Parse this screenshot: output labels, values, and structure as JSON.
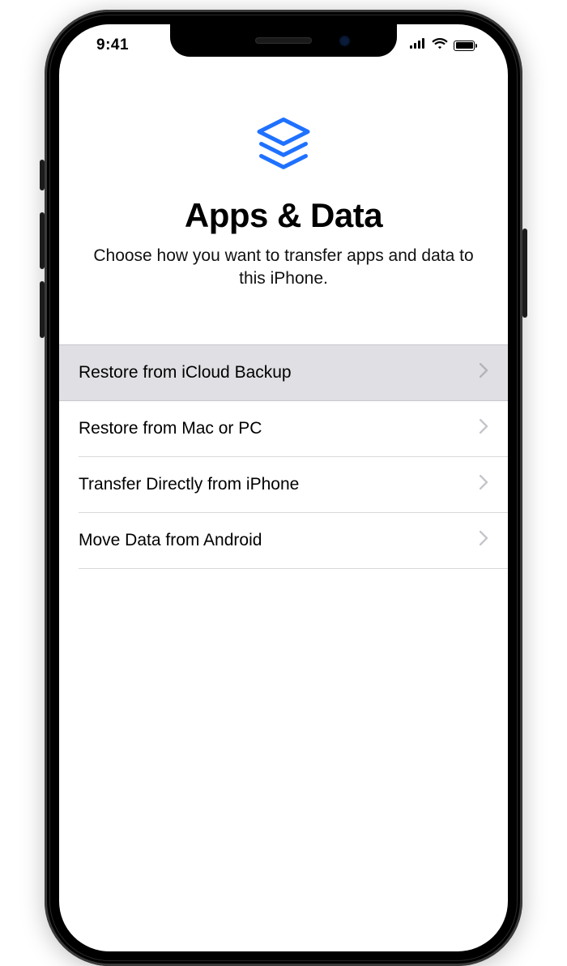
{
  "status": {
    "time": "9:41"
  },
  "colors": {
    "accent": "#1f71ff",
    "selected_bg": "#e0dfe3"
  },
  "hero": {
    "icon_name": "layers-icon",
    "title": "Apps & Data",
    "subtitle": "Choose how you want to transfer apps and data to this iPhone."
  },
  "options": [
    {
      "label": "Restore from iCloud Backup",
      "selected": true
    },
    {
      "label": "Restore from Mac or PC",
      "selected": false
    },
    {
      "label": "Transfer Directly from iPhone",
      "selected": false
    },
    {
      "label": "Move Data from Android",
      "selected": false
    }
  ]
}
